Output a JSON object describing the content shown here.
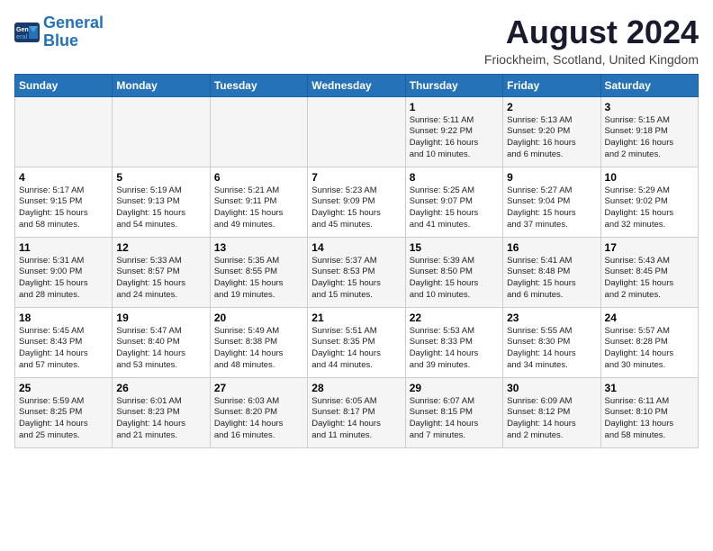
{
  "logo": {
    "line1": "General",
    "line2": "Blue"
  },
  "title": "August 2024",
  "location": "Friockheim, Scotland, United Kingdom",
  "weekdays": [
    "Sunday",
    "Monday",
    "Tuesday",
    "Wednesday",
    "Thursday",
    "Friday",
    "Saturday"
  ],
  "weeks": [
    [
      {
        "day": "",
        "text": ""
      },
      {
        "day": "",
        "text": ""
      },
      {
        "day": "",
        "text": ""
      },
      {
        "day": "",
        "text": ""
      },
      {
        "day": "1",
        "text": "Sunrise: 5:11 AM\nSunset: 9:22 PM\nDaylight: 16 hours\nand 10 minutes."
      },
      {
        "day": "2",
        "text": "Sunrise: 5:13 AM\nSunset: 9:20 PM\nDaylight: 16 hours\nand 6 minutes."
      },
      {
        "day": "3",
        "text": "Sunrise: 5:15 AM\nSunset: 9:18 PM\nDaylight: 16 hours\nand 2 minutes."
      }
    ],
    [
      {
        "day": "4",
        "text": "Sunrise: 5:17 AM\nSunset: 9:15 PM\nDaylight: 15 hours\nand 58 minutes."
      },
      {
        "day": "5",
        "text": "Sunrise: 5:19 AM\nSunset: 9:13 PM\nDaylight: 15 hours\nand 54 minutes."
      },
      {
        "day": "6",
        "text": "Sunrise: 5:21 AM\nSunset: 9:11 PM\nDaylight: 15 hours\nand 49 minutes."
      },
      {
        "day": "7",
        "text": "Sunrise: 5:23 AM\nSunset: 9:09 PM\nDaylight: 15 hours\nand 45 minutes."
      },
      {
        "day": "8",
        "text": "Sunrise: 5:25 AM\nSunset: 9:07 PM\nDaylight: 15 hours\nand 41 minutes."
      },
      {
        "day": "9",
        "text": "Sunrise: 5:27 AM\nSunset: 9:04 PM\nDaylight: 15 hours\nand 37 minutes."
      },
      {
        "day": "10",
        "text": "Sunrise: 5:29 AM\nSunset: 9:02 PM\nDaylight: 15 hours\nand 32 minutes."
      }
    ],
    [
      {
        "day": "11",
        "text": "Sunrise: 5:31 AM\nSunset: 9:00 PM\nDaylight: 15 hours\nand 28 minutes."
      },
      {
        "day": "12",
        "text": "Sunrise: 5:33 AM\nSunset: 8:57 PM\nDaylight: 15 hours\nand 24 minutes."
      },
      {
        "day": "13",
        "text": "Sunrise: 5:35 AM\nSunset: 8:55 PM\nDaylight: 15 hours\nand 19 minutes."
      },
      {
        "day": "14",
        "text": "Sunrise: 5:37 AM\nSunset: 8:53 PM\nDaylight: 15 hours\nand 15 minutes."
      },
      {
        "day": "15",
        "text": "Sunrise: 5:39 AM\nSunset: 8:50 PM\nDaylight: 15 hours\nand 10 minutes."
      },
      {
        "day": "16",
        "text": "Sunrise: 5:41 AM\nSunset: 8:48 PM\nDaylight: 15 hours\nand 6 minutes."
      },
      {
        "day": "17",
        "text": "Sunrise: 5:43 AM\nSunset: 8:45 PM\nDaylight: 15 hours\nand 2 minutes."
      }
    ],
    [
      {
        "day": "18",
        "text": "Sunrise: 5:45 AM\nSunset: 8:43 PM\nDaylight: 14 hours\nand 57 minutes."
      },
      {
        "day": "19",
        "text": "Sunrise: 5:47 AM\nSunset: 8:40 PM\nDaylight: 14 hours\nand 53 minutes."
      },
      {
        "day": "20",
        "text": "Sunrise: 5:49 AM\nSunset: 8:38 PM\nDaylight: 14 hours\nand 48 minutes."
      },
      {
        "day": "21",
        "text": "Sunrise: 5:51 AM\nSunset: 8:35 PM\nDaylight: 14 hours\nand 44 minutes."
      },
      {
        "day": "22",
        "text": "Sunrise: 5:53 AM\nSunset: 8:33 PM\nDaylight: 14 hours\nand 39 minutes."
      },
      {
        "day": "23",
        "text": "Sunrise: 5:55 AM\nSunset: 8:30 PM\nDaylight: 14 hours\nand 34 minutes."
      },
      {
        "day": "24",
        "text": "Sunrise: 5:57 AM\nSunset: 8:28 PM\nDaylight: 14 hours\nand 30 minutes."
      }
    ],
    [
      {
        "day": "25",
        "text": "Sunrise: 5:59 AM\nSunset: 8:25 PM\nDaylight: 14 hours\nand 25 minutes."
      },
      {
        "day": "26",
        "text": "Sunrise: 6:01 AM\nSunset: 8:23 PM\nDaylight: 14 hours\nand 21 minutes."
      },
      {
        "day": "27",
        "text": "Sunrise: 6:03 AM\nSunset: 8:20 PM\nDaylight: 14 hours\nand 16 minutes."
      },
      {
        "day": "28",
        "text": "Sunrise: 6:05 AM\nSunset: 8:17 PM\nDaylight: 14 hours\nand 11 minutes."
      },
      {
        "day": "29",
        "text": "Sunrise: 6:07 AM\nSunset: 8:15 PM\nDaylight: 14 hours\nand 7 minutes."
      },
      {
        "day": "30",
        "text": "Sunrise: 6:09 AM\nSunset: 8:12 PM\nDaylight: 14 hours\nand 2 minutes."
      },
      {
        "day": "31",
        "text": "Sunrise: 6:11 AM\nSunset: 8:10 PM\nDaylight: 13 hours\nand 58 minutes."
      }
    ]
  ]
}
